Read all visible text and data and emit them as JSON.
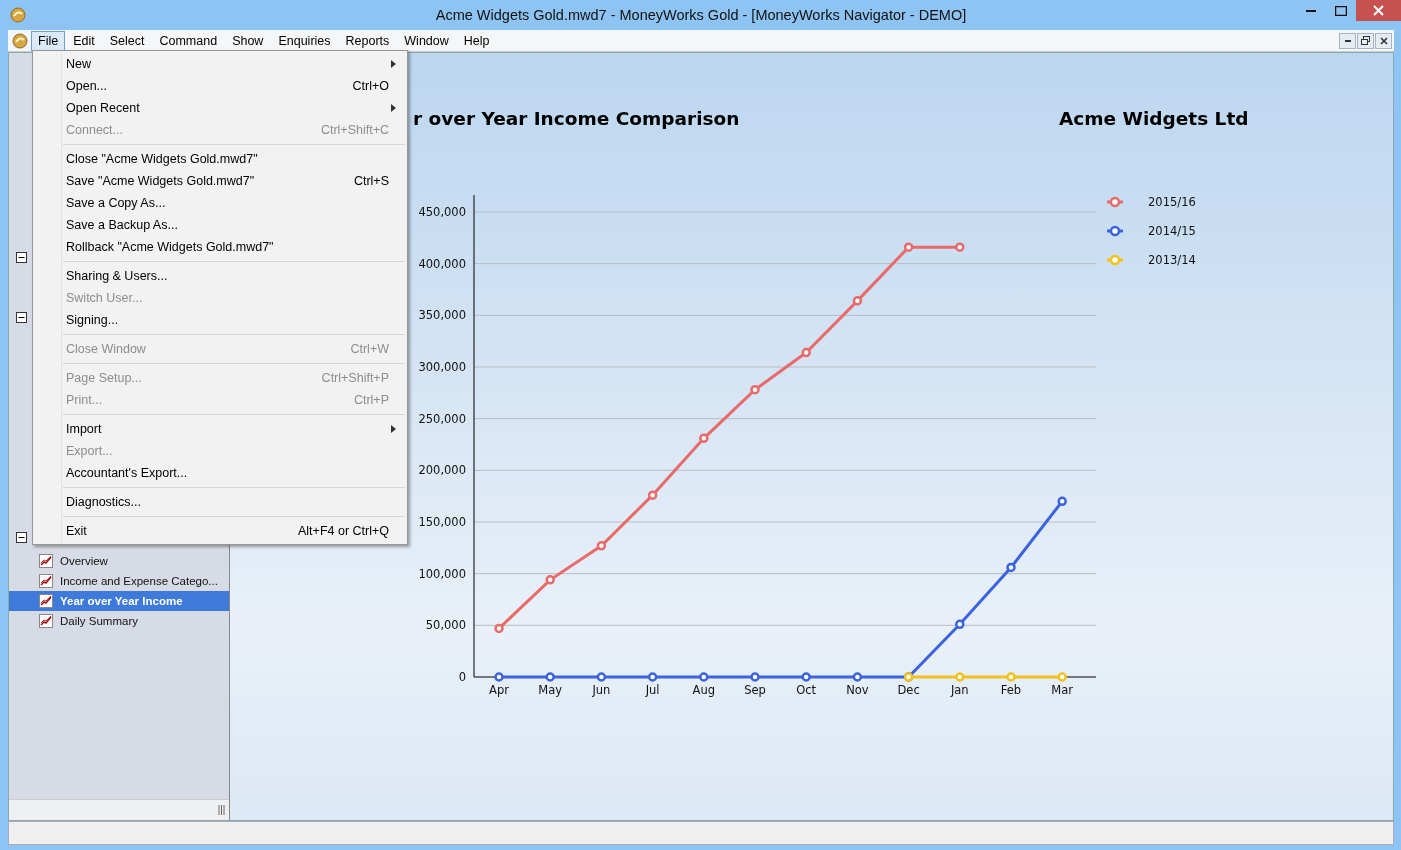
{
  "window": {
    "title": "Acme Widgets Gold.mwd7 - MoneyWorks Gold - [MoneyWorks Navigator - DEMO]"
  },
  "menubar": [
    {
      "label": "File",
      "selected": true
    },
    {
      "label": "Edit",
      "selected": false
    },
    {
      "label": "Select",
      "selected": false
    },
    {
      "label": "Command",
      "selected": false
    },
    {
      "label": "Show",
      "selected": false
    },
    {
      "label": "Enquiries",
      "selected": false
    },
    {
      "label": "Reports",
      "selected": false
    },
    {
      "label": "Window",
      "selected": false
    },
    {
      "label": "Help",
      "selected": false
    }
  ],
  "file_menu": [
    {
      "kind": "item",
      "label": "New",
      "submenu": true,
      "disabled": false
    },
    {
      "kind": "item",
      "label": "Open...",
      "shortcut": "Ctrl+O",
      "submenu": false,
      "disabled": false
    },
    {
      "kind": "item",
      "label": "Open Recent",
      "submenu": true,
      "disabled": false
    },
    {
      "kind": "item",
      "label": "Connect...",
      "shortcut": "Ctrl+Shift+C",
      "submenu": false,
      "disabled": true
    },
    {
      "kind": "separator"
    },
    {
      "kind": "item",
      "label": "Close \"Acme Widgets Gold.mwd7\"",
      "submenu": false,
      "disabled": false
    },
    {
      "kind": "item",
      "label": "Save \"Acme Widgets Gold.mwd7\"",
      "shortcut": "Ctrl+S",
      "submenu": false,
      "disabled": false
    },
    {
      "kind": "item",
      "label": "Save a Copy As...",
      "submenu": false,
      "disabled": false
    },
    {
      "kind": "item",
      "label": "Save a Backup As...",
      "submenu": false,
      "disabled": false
    },
    {
      "kind": "item",
      "label": "Rollback \"Acme Widgets Gold.mwd7\"",
      "submenu": false,
      "disabled": false
    },
    {
      "kind": "separator"
    },
    {
      "kind": "item",
      "label": "Sharing & Users...",
      "submenu": false,
      "disabled": false
    },
    {
      "kind": "item",
      "label": "Switch User...",
      "submenu": false,
      "disabled": true
    },
    {
      "kind": "item",
      "label": "Signing...",
      "submenu": false,
      "disabled": false
    },
    {
      "kind": "separator"
    },
    {
      "kind": "item",
      "label": "Close Window",
      "shortcut": "Ctrl+W",
      "submenu": false,
      "disabled": true
    },
    {
      "kind": "separator"
    },
    {
      "kind": "item",
      "label": "Page Setup...",
      "shortcut": "Ctrl+Shift+P",
      "submenu": false,
      "disabled": true
    },
    {
      "kind": "item",
      "label": "Print...",
      "shortcut": "Ctrl+P",
      "submenu": false,
      "disabled": true
    },
    {
      "kind": "separator"
    },
    {
      "kind": "item",
      "label": "Import",
      "submenu": true,
      "disabled": false
    },
    {
      "kind": "item",
      "label": "Export...",
      "submenu": false,
      "disabled": true
    },
    {
      "kind": "item",
      "label": "Accountant's Export...",
      "submenu": false,
      "disabled": false
    },
    {
      "kind": "separator"
    },
    {
      "kind": "item",
      "label": "Diagnostics...",
      "submenu": false,
      "disabled": false
    },
    {
      "kind": "separator"
    },
    {
      "kind": "item",
      "label": "Exit",
      "shortcut": "Alt+F4 or Ctrl+Q",
      "submenu": false,
      "disabled": false
    }
  ],
  "sidebar": {
    "groups": [
      {
        "expanded": true
      },
      {
        "expanded": true
      },
      {
        "expanded": true,
        "items": [
          {
            "label": "Overview",
            "selected": false
          },
          {
            "label": "Income and Expense Catego...",
            "selected": false
          },
          {
            "label": "Year over Year Income",
            "selected": true
          },
          {
            "label": "Daily Summary",
            "selected": false
          }
        ]
      }
    ]
  },
  "report": {
    "title": "r over Year Income Comparison",
    "company": "Acme Widgets Ltd",
    "chart_data": {
      "type": "line",
      "categories": [
        "Apr",
        "May",
        "Jun",
        "Jul",
        "Aug",
        "Sep",
        "Oct",
        "Nov",
        "Dec",
        "Jan",
        "Feb",
        "Mar"
      ],
      "ylim": [
        0,
        450000
      ],
      "grid": true,
      "legend": true,
      "yticks": [
        {
          "value": 0,
          "label": "0"
        },
        {
          "value": 50000,
          "label": "50,000"
        },
        {
          "value": 100000,
          "label": "100,000"
        },
        {
          "value": 150000,
          "label": "150,000"
        },
        {
          "value": 200000,
          "label": "200,000"
        },
        {
          "value": 250000,
          "label": "250,000"
        },
        {
          "value": 300000,
          "label": "300,000"
        },
        {
          "value": 350000,
          "label": "350,000"
        },
        {
          "value": 400000,
          "label": "400,000"
        },
        {
          "value": 450000,
          "label": "450,000"
        }
      ],
      "series": [
        {
          "name": "2015/16",
          "color": "#e86a6a",
          "marker": "circle",
          "values": [
            47000,
            94000,
            127000,
            176000,
            231000,
            278000,
            314000,
            364000,
            416000,
            416000,
            null,
            null
          ]
        },
        {
          "name": "2014/15",
          "color": "#3b63e0",
          "marker": "circle",
          "values": [
            0,
            0,
            0,
            0,
            0,
            0,
            0,
            0,
            0,
            51000,
            106000,
            170000
          ]
        },
        {
          "name": "2013/14",
          "color": "#f2c21b",
          "marker": "circle",
          "values": [
            null,
            null,
            null,
            null,
            null,
            null,
            null,
            null,
            0,
            0,
            0,
            0
          ]
        }
      ]
    }
  }
}
